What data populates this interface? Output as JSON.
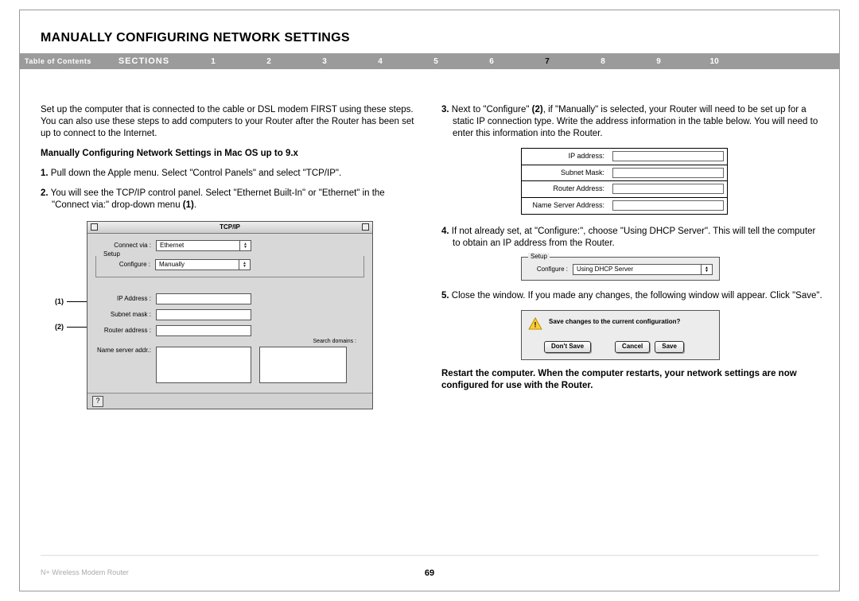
{
  "heading": "MANUALLY CONFIGURING NETWORK SETTINGS",
  "nav": {
    "toc": "Table of Contents",
    "sections_label": "SECTIONS",
    "items": [
      "1",
      "2",
      "3",
      "4",
      "5",
      "6",
      "7",
      "8",
      "9",
      "10"
    ],
    "active": "7"
  },
  "left": {
    "intro": "Set up the computer that is connected to the cable or DSL modem FIRST using these steps. You can also use these steps to add computers to your Router after the Router has been set up to connect to the Internet.",
    "subhead": "Manually Configuring Network Settings in Mac OS up to 9.x",
    "step1_num": "1.",
    "step1": " Pull down the Apple menu. Select \"Control Panels\" and select \"TCP/IP\".",
    "step2_num": "2.",
    "step2": " You will see the TCP/IP control panel. Select \"Ethernet Built-In\" or \"Ethernet\" in the \"Connect via:\" drop-down menu ",
    "step2_ref": "(1)",
    "step2_end": ".",
    "callout1": "(1)",
    "callout2": "(2)"
  },
  "tcpip": {
    "title": "TCP/IP",
    "connect_via_label": "Connect via :",
    "connect_via_value": "Ethernet",
    "setup_legend": "Setup",
    "configure_label": "Configure :",
    "configure_value": "Manually",
    "ip_label": "IP Address :",
    "subnet_label": "Subnet mask :",
    "router_label": "Router address :",
    "ns_label": "Name server addr.:",
    "search_label": "Search domains :",
    "qmark": "?"
  },
  "right": {
    "step3_num": "3.",
    "step3a": " Next to \"Configure\" ",
    "step3_ref": "(2)",
    "step3b": ", if \"Manually\" is selected, your Router will need to be set up for a static IP connection type. Write the address information in the table below. You will need to enter this information into the Router.",
    "addr_labels": {
      "ip": "IP address:",
      "subnet": "Subnet Mask:",
      "router": "Router Address:",
      "ns": "Name Server Address:"
    },
    "step4_num": "4.",
    "step4": " If not already set, at \"Configure:\", choose \"Using DHCP Server\". This will tell the computer to obtain an IP address from the Router.",
    "dhcp": {
      "legend": "Setup",
      "label": "Configure :",
      "value": "Using DHCP Server"
    },
    "step5_num": "5.",
    "step5": " Close the window. If you made any changes, the following window will appear. Click \"Save\".",
    "save_dialog": {
      "msg": "Save changes to the current configuration?",
      "dont_save": "Don't Save",
      "cancel": "Cancel",
      "save": "Save"
    },
    "restart": "Restart the computer. When the computer restarts, your network settings are now configured for use with the Router."
  },
  "footer": {
    "product": "N+ Wireless Modem Router",
    "page": "69"
  }
}
